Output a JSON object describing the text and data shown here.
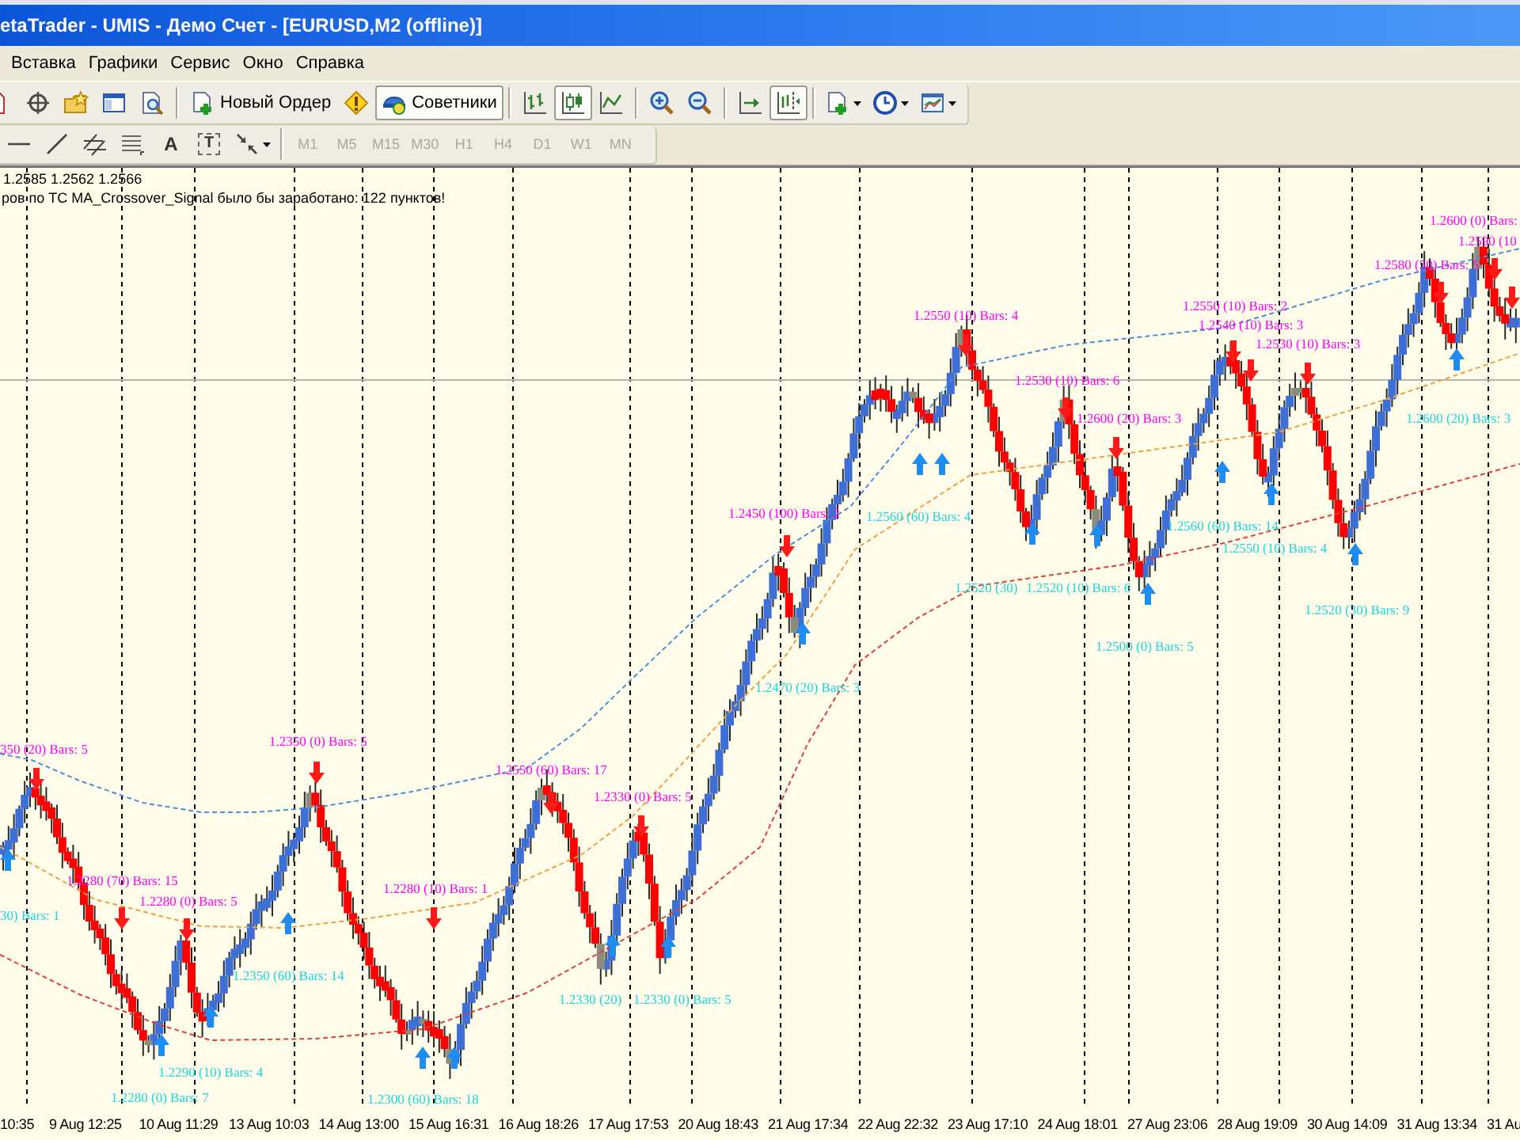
{
  "window": {
    "title": "etaTrader - UMIS - Демо Счет - [EURUSD,M2 (offline)]"
  },
  "menu": [
    "Вставка",
    "Графики",
    "Сервис",
    "Окно",
    "Справка"
  ],
  "toolbar": {
    "new_order_button": "Новый Ордер",
    "experts_button": {
      "label": "Советники",
      "on": true
    },
    "chart_types": [
      {
        "selected": false
      },
      {
        "selected": true
      },
      {
        "selected": false
      }
    ],
    "auto_scroll": {
      "on": false
    },
    "chart_shift": {
      "on": true
    }
  },
  "drawing_toolbar": {
    "text_tool": "A",
    "label_tool": "T"
  },
  "timeframes": [
    {
      "label": "M1",
      "disabled": true
    },
    {
      "label": "M5",
      "disabled": true
    },
    {
      "label": "M15",
      "disabled": true
    },
    {
      "label": "M30",
      "disabled": true
    },
    {
      "label": "H1",
      "disabled": true
    },
    {
      "label": "H4",
      "disabled": true
    },
    {
      "label": "D1",
      "disabled": true
    },
    {
      "label": "W1",
      "disabled": true
    },
    {
      "label": "MN",
      "disabled": true
    }
  ],
  "chart": {
    "header": {
      "prices": "1.2585 1.2562 1.2566",
      "summary": "ров по ТС MA_Crossover_Signal было бы заработано: 122 пунктов!"
    },
    "signal_labels": [
      {
        "text": "1.2600 (0) Bars:",
        "kind": "high"
      },
      {
        "text": "1.2590 (10",
        "kind": "high"
      },
      {
        "text": "1.2580 (50) Bars: 5",
        "kind": "high"
      },
      {
        "text": "1.2550 (10) Bars: 2",
        "kind": "high"
      },
      {
        "text": "1.2550 (10) Bars: 4",
        "kind": "high"
      },
      {
        "text": "1.2540 (10) Bars: 3",
        "kind": "high"
      },
      {
        "text": "1.2530 (10) Bars: 3",
        "kind": "high"
      },
      {
        "text": "1.2530 (10) Bars: 6",
        "kind": "high"
      },
      {
        "text": "1.2600 (20) Bars: 3",
        "kind": "high"
      },
      {
        "text": "1.2600 (20) Bars: 3",
        "kind": "low"
      },
      {
        "text": "1.2450 (100) Bars: 2",
        "kind": "high"
      },
      {
        "text": "1.2560 (60) Bars: 4",
        "kind": "low"
      },
      {
        "text": "1.2560 (60) Bars: 14",
        "kind": "low"
      },
      {
        "text": "1.2550 (10) Bars: 4",
        "kind": "low"
      },
      {
        "text": "1.2520 (30)",
        "kind": "low"
      },
      {
        "text": "1.2520 (10) Bars: 6",
        "kind": "low"
      },
      {
        "text": "1.2520 (30) Bars: 9",
        "kind": "low"
      },
      {
        "text": "1.2500 (0) Bars: 5",
        "kind": "low"
      },
      {
        "text": "1.2470 (20) Bars: 3",
        "kind": "low"
      },
      {
        "text": "1.2350 (0) Bars: 5",
        "kind": "high"
      },
      {
        "text": "350 (20) Bars: 5",
        "kind": "high"
      },
      {
        "text": "1.2550 (60) Bars: 17",
        "kind": "high"
      },
      {
        "text": "1.2330 (0) Bars: 5",
        "kind": "high"
      },
      {
        "text": "1.2280 (70) Bars: 15",
        "kind": "high"
      },
      {
        "text": "1.2280 (10) Bars: 1",
        "kind": "high"
      },
      {
        "text": "1.2280 (0) Bars: 5",
        "kind": "high"
      },
      {
        "text": "30) Bars: 1",
        "kind": "low"
      },
      {
        "text": "1.2350 (60) Bars: 14",
        "kind": "low"
      },
      {
        "text": "1.2330 (20)",
        "kind": "low"
      },
      {
        "text": "1.2330 (0) Bars: 5",
        "kind": "low"
      },
      {
        "text": "1.2290 (10) Bars: 4",
        "kind": "low"
      },
      {
        "text": "1.2280 (0) Bars: 7",
        "kind": "low"
      },
      {
        "text": "1.2300 (60) Bars: 18",
        "kind": "low"
      }
    ],
    "time_axis": [
      "10:35",
      "9 Aug 12:25",
      "10 Aug 11:29",
      "13 Aug 10:03",
      "14 Aug 13:00",
      "15 Aug 16:31",
      "16 Aug 18:26",
      "17 Aug 17:53",
      "20 Aug 18:43",
      "21 Aug 17:34",
      "22 Aug 22:32",
      "23 Aug 17:10",
      "24 Aug 18:01",
      "27 Aug 23:06",
      "28 Aug 19:09",
      "30 Aug 14:09",
      "31 Aug 13:34",
      "31 Au"
    ]
  }
}
